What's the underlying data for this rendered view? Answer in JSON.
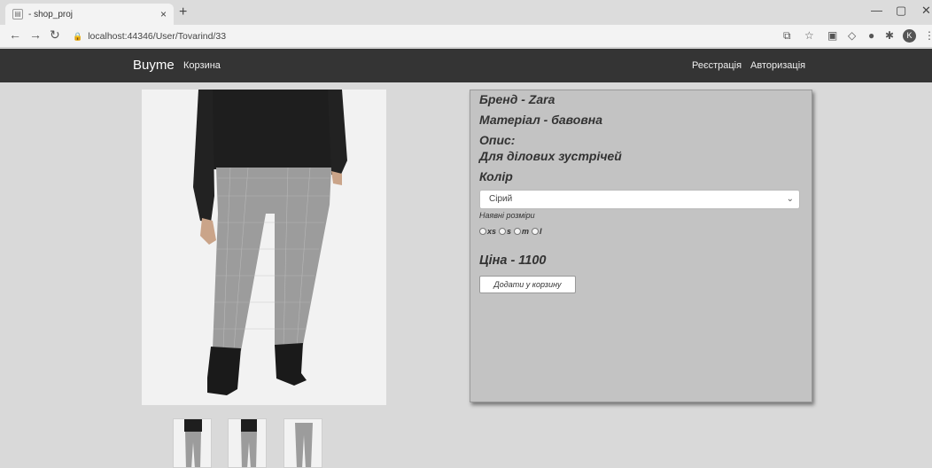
{
  "browser": {
    "tab_title": "- shop_proj",
    "tab_close": "×",
    "new_tab": "+",
    "url": "localhost:44346/User/Tovarind/33",
    "profile_initial": "K"
  },
  "navbar": {
    "brand": "Buyme",
    "cart": "Корзина",
    "register": "Реєстрація",
    "login": "Авторизація"
  },
  "product": {
    "brand_line": "Бренд - Zara",
    "material_line": "Матеріал - бавовна",
    "description_label": "Опис:",
    "description": "Для ділових зустрічей",
    "color_label": "Колір",
    "color_selected": "Сірий",
    "sizes_label": "Наявні розміри",
    "sizes": [
      "xs",
      "s",
      "m",
      "l"
    ],
    "price_line": "Ціна - 1100",
    "add_to_cart": "Додати у корзину"
  },
  "colors": {
    "navbar_bg": "#343434",
    "page_bg": "#d9d9d9",
    "card_bg": "#c3c3c3"
  }
}
